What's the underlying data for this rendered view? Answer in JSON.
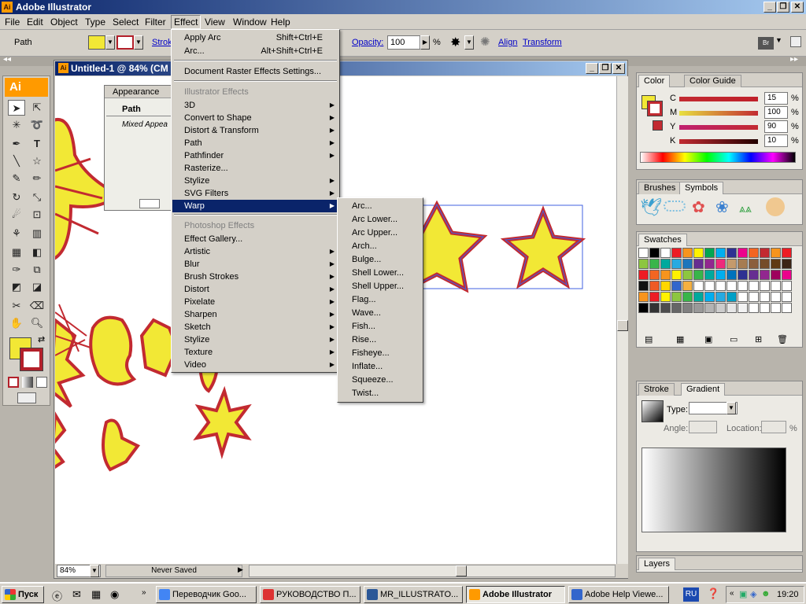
{
  "app": {
    "title": "Adobe Illustrator",
    "icon_label": "Ai"
  },
  "menubar": {
    "items": [
      "File",
      "Edit",
      "Object",
      "Type",
      "Select",
      "Filter",
      "Effect",
      "View",
      "Window",
      "Help"
    ]
  },
  "control": {
    "selection": "Path",
    "stroke_label": "Strok",
    "opacity_label": "Opacity:",
    "opacity_value": "100",
    "percent": "%",
    "align": "Align",
    "transform": "Transform",
    "fill_color": "#f2e835",
    "stroke_color": "#b3202a"
  },
  "document": {
    "title": "Untitled-1 @ 84% (CM",
    "zoom": "84%",
    "status": "Never Saved"
  },
  "appearance_panel": {
    "tab": "Appearance",
    "row1": "Path",
    "row2": "Mixed Appea"
  },
  "effect_menu": {
    "apply_last": "Apply Arc",
    "apply_last_sc": "Shift+Ctrl+E",
    "last": "Arc...",
    "last_sc": "Alt+Shift+Ctrl+E",
    "doc_raster": "Document Raster Effects Settings...",
    "ill_header": "Illustrator Effects",
    "ill_items": [
      "3D",
      "Convert to Shape",
      "Distort & Transform",
      "Path",
      "Pathfinder",
      "Rasterize...",
      "Stylize",
      "SVG Filters",
      "Warp"
    ],
    "ps_header": "Photoshop Effects",
    "ps_items": [
      "Effect Gallery...",
      "Artistic",
      "Blur",
      "Brush Strokes",
      "Distort",
      "Pixelate",
      "Sharpen",
      "Sketch",
      "Stylize",
      "Texture",
      "Video"
    ]
  },
  "warp_menu": {
    "items": [
      "Arc...",
      "Arc Lower...",
      "Arc Upper...",
      "Arch...",
      "Bulge...",
      "Shell Lower...",
      "Shell Upper...",
      "Flag...",
      "Wave...",
      "Fish...",
      "Rise...",
      "Fisheye...",
      "Inflate...",
      "Squeeze...",
      "Twist..."
    ]
  },
  "color_panel": {
    "tabs": [
      "Color",
      "Color Guide"
    ],
    "channels": [
      {
        "label": "C",
        "value": "15",
        "pct": "%"
      },
      {
        "label": "M",
        "value": "100",
        "pct": "%"
      },
      {
        "label": "Y",
        "value": "90",
        "pct": "%"
      },
      {
        "label": "K",
        "value": "10",
        "pct": "%"
      }
    ]
  },
  "brushes_panel": {
    "tabs": [
      "Brushes",
      "Symbols"
    ]
  },
  "swatches_panel": {
    "tabs": [
      "Swatches"
    ]
  },
  "gradient_panel": {
    "tabs": [
      "Stroke",
      "Gradient"
    ],
    "type_label": "Type:",
    "angle_label": "Angle:",
    "location_label": "Location:",
    "location_pct": "%"
  },
  "layers_panel": {
    "tabs": [
      "Layers"
    ]
  },
  "taskbar": {
    "start": "Пуск",
    "buttons": [
      "Переводчик Goo...",
      "РУКОВОДСТВО П...",
      "MR_ILLUSTRATO...",
      "Adobe Illustrator",
      "Adobe Help Viewe..."
    ],
    "lang": "RU",
    "clock": "19:20"
  }
}
